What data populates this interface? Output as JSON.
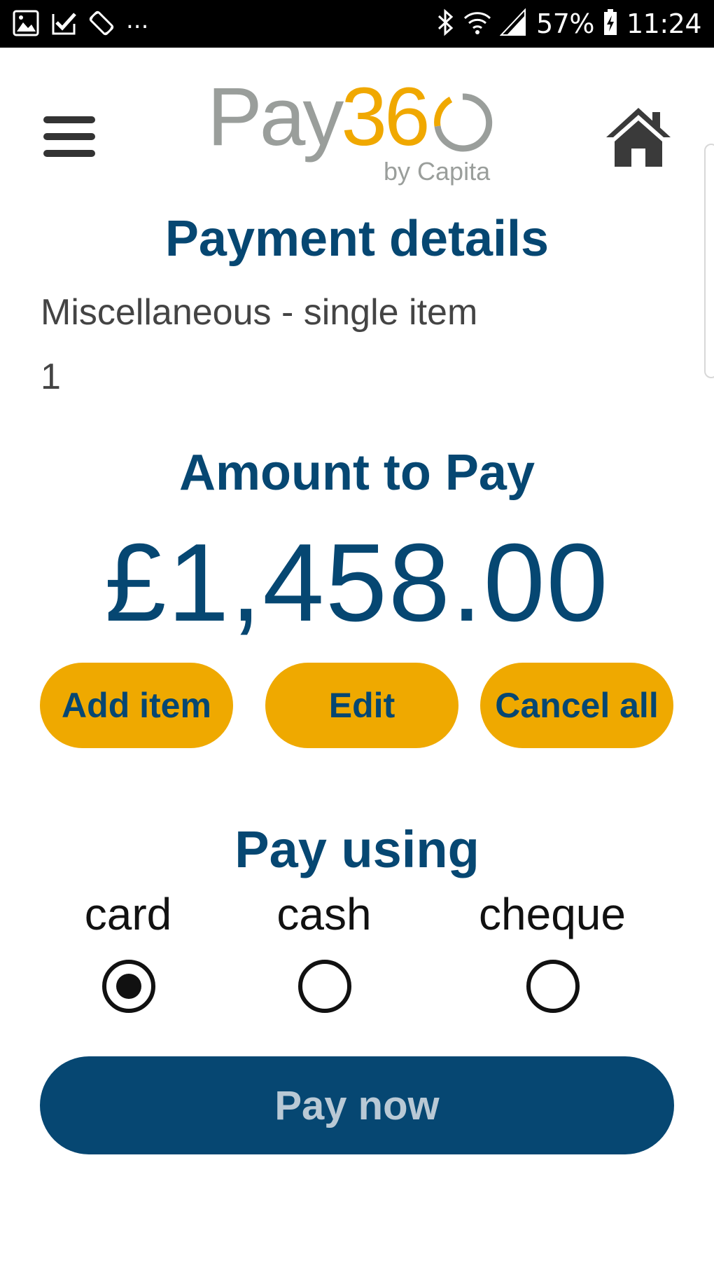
{
  "status_bar": {
    "left_icons": [
      "gallery-icon",
      "task-check-icon",
      "screen-rotate-icon"
    ],
    "overflow": "...",
    "right_icons": [
      "bluetooth-icon",
      "wifi-icon",
      "signal-icon"
    ],
    "battery": "57%",
    "time": "11:24"
  },
  "header": {
    "menu_icon": "hamburger-menu-icon",
    "home_icon": "home-icon",
    "logo": {
      "word": "Pay",
      "number": "36",
      "byline": "by Capita"
    }
  },
  "colors": {
    "brand_blue": "#064772",
    "brand_gold": "#efa900",
    "logo_grey": "#9a9e9b"
  },
  "page": {
    "title": "Payment details",
    "item_name": "Miscellaneous - single item",
    "item_quantity": "1",
    "amount_label": "Amount to Pay",
    "amount_value": "£1,458.00"
  },
  "actions": {
    "add_item": "Add item",
    "edit": "Edit",
    "cancel_all": "Cancel all"
  },
  "payment_method": {
    "title": "Pay using",
    "options": [
      {
        "label": "card",
        "selected": true
      },
      {
        "label": "cash",
        "selected": false
      },
      {
        "label": "cheque",
        "selected": false
      }
    ]
  },
  "pay_now_label": "Pay now"
}
